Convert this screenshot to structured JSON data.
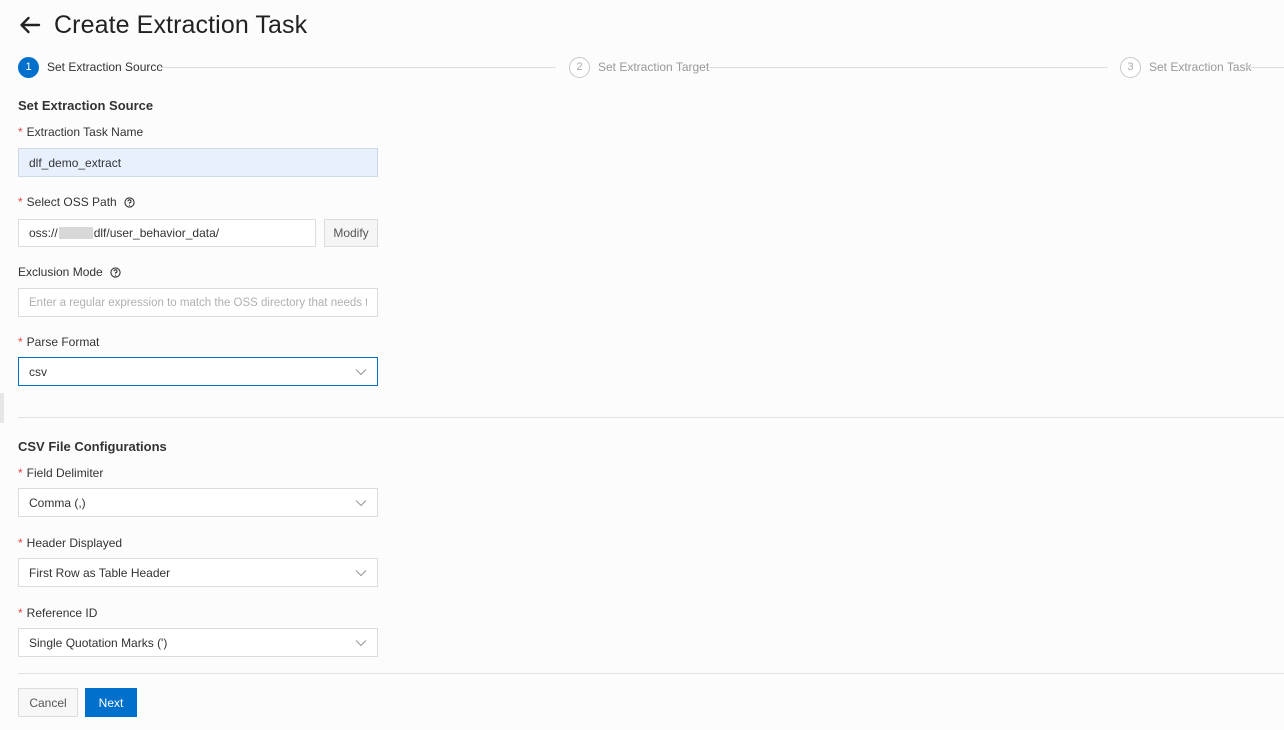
{
  "header": {
    "title": "Create Extraction Task",
    "back_icon": "arrow-left-icon"
  },
  "steps": [
    {
      "number": "1",
      "label": "Set Extraction Source",
      "state": "active"
    },
    {
      "number": "2",
      "label": "Set Extraction Target",
      "state": "inactive"
    },
    {
      "number": "3",
      "label": "Set Extraction Task",
      "state": "inactive"
    }
  ],
  "source_section": {
    "title": "Set Extraction Source",
    "task_name": {
      "label": "Extraction Task Name",
      "required": true,
      "value": "dlf_demo_extract"
    },
    "oss_path": {
      "label": "Select OSS Path",
      "required": true,
      "value_prefix": "oss://",
      "value_suffix": "dlf/user_behavior_data/",
      "modify_label": "Modify"
    },
    "exclusion_mode": {
      "label": "Exclusion Mode",
      "required": false,
      "placeholder": "Enter a regular expression to match the OSS directory that needs to b..."
    },
    "parse_format": {
      "label": "Parse Format",
      "required": true,
      "value": "csv"
    }
  },
  "csv_section": {
    "title": "CSV File Configurations",
    "field_delimiter": {
      "label": "Field Delimiter",
      "required": true,
      "value": "Comma (,)"
    },
    "header_displayed": {
      "label": "Header Displayed",
      "required": true,
      "value": "First Row as Table Header"
    },
    "reference_id": {
      "label": "Reference ID",
      "required": true,
      "value": "Single Quotation Marks (')"
    }
  },
  "footer": {
    "cancel_label": "Cancel",
    "next_label": "Next"
  },
  "colors": {
    "primary": "#0070cc",
    "required": "#e54545",
    "filled_input_bg": "#e8f0fe"
  }
}
